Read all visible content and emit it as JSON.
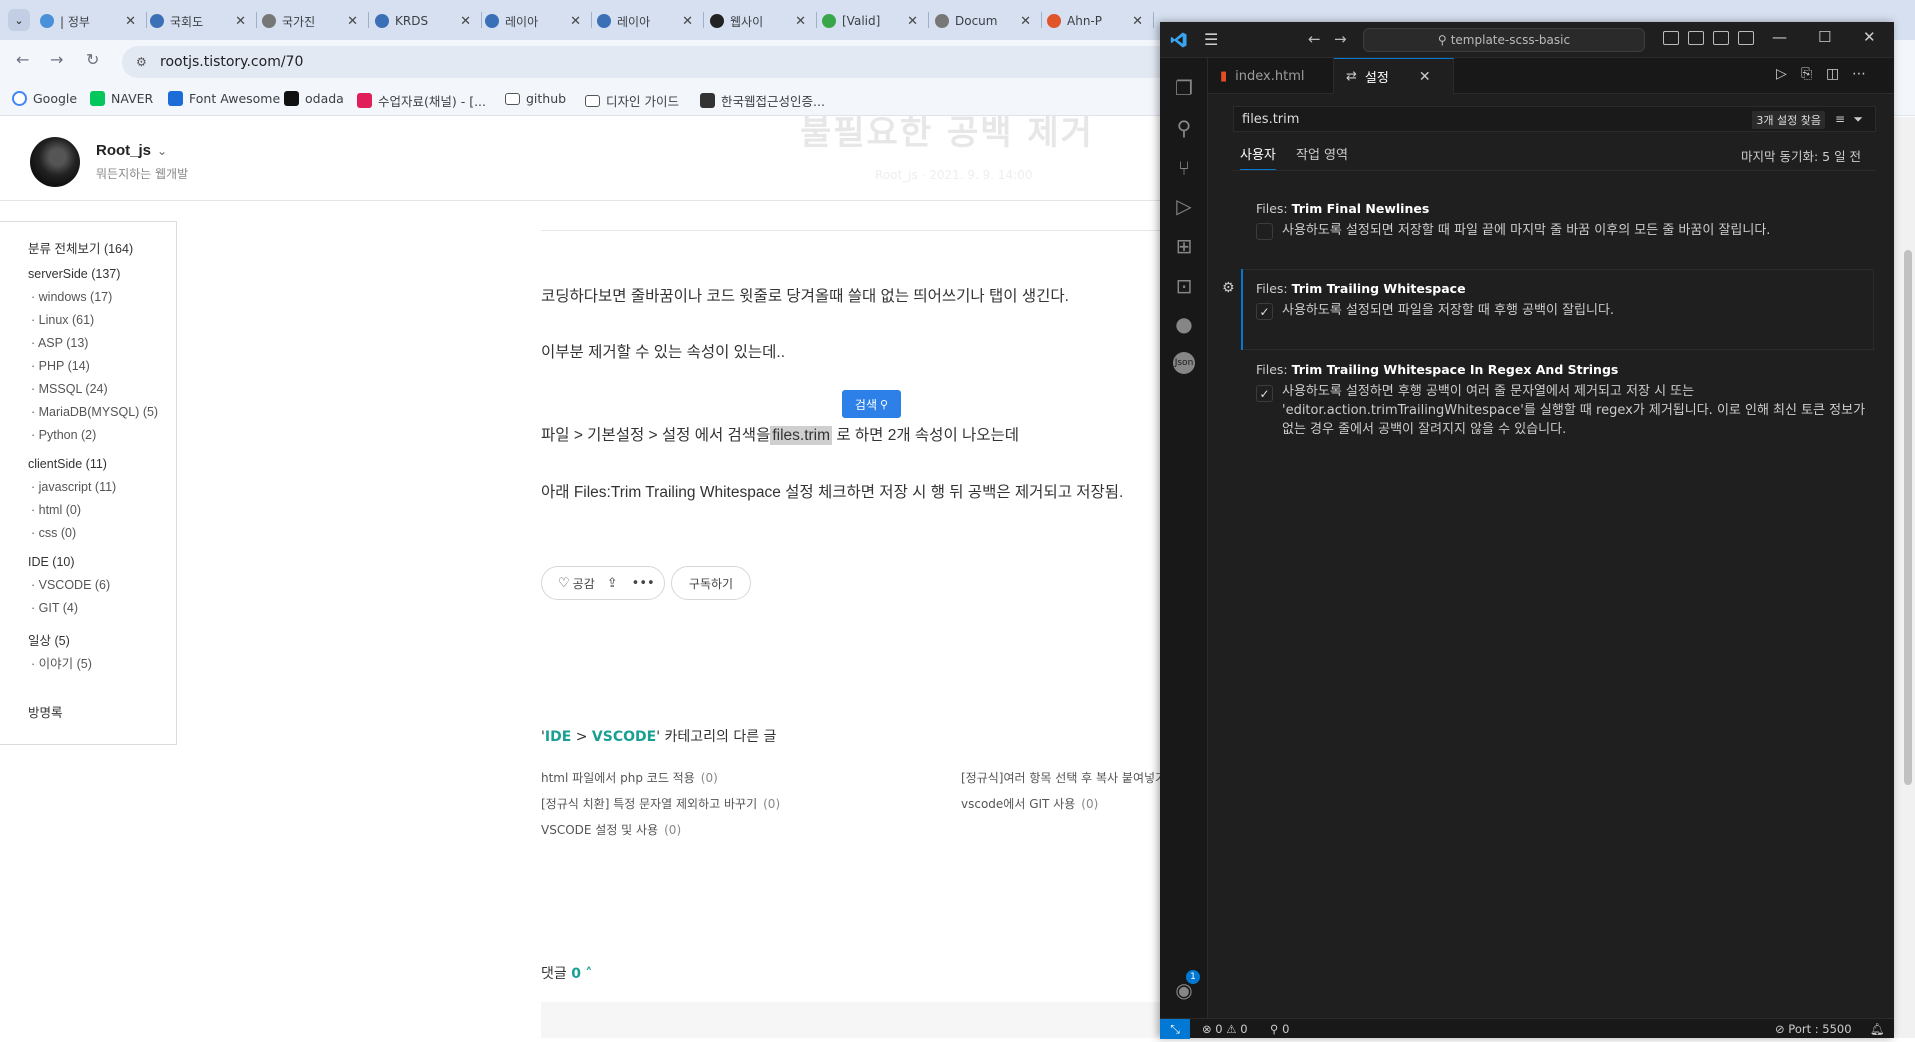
{
  "browser": {
    "tabs": [
      {
        "label": "| 정부",
        "color": "#4a90d9"
      },
      {
        "label": "국회도",
        "color": "#3b6fb6"
      },
      {
        "label": "국가진",
        "color": "#777777"
      },
      {
        "label": "KRDS",
        "color": "#3b6fb6"
      },
      {
        "label": "레이아",
        "color": "#3b6fb6"
      },
      {
        "label": "레이아",
        "color": "#3b6fb6"
      },
      {
        "label": "웹사이",
        "color": "#222222"
      },
      {
        "label": "[Valid]",
        "color": "#3aa64a"
      },
      {
        "label": "Docum",
        "color": "#777777"
      },
      {
        "label": "Ahn-P",
        "color": "#e0552a"
      }
    ],
    "url": "rootjs.tistory.com/70",
    "bookmarks": [
      {
        "label": "Google",
        "icon": "google-icon",
        "color": "#4285f4"
      },
      {
        "label": "NAVER",
        "icon": "naver-icon",
        "color": "#03c75a"
      },
      {
        "label": "Font Awesome",
        "icon": "flag-icon",
        "color": "#1c6bd6"
      },
      {
        "label": "odada",
        "icon": "odada-icon",
        "color": "#111111"
      },
      {
        "label": "수업자료(채널) - [...",
        "icon": "slack-icon",
        "color": "#e01e5a"
      },
      {
        "label": "github",
        "icon": "folder-icon",
        "color": "#ffffff"
      },
      {
        "label": "디자인 가이드",
        "icon": "folder-icon",
        "color": "#ffffff"
      },
      {
        "label": "한국웹접근성인증...",
        "icon": "globe-icon",
        "color": "#333333"
      }
    ]
  },
  "blog": {
    "name": "Root_js",
    "desc": "뭐든지하는 웹개발",
    "ghost_title": "불필요한 공백 제거",
    "ghost_meta": "Root_js · 2021. 9. 9. 14:00",
    "categories": [
      {
        "label": "분류 전체보기 (164)",
        "sub": false
      },
      {
        "label": "serverSide (137)",
        "sub": false
      },
      {
        "label": "· windows (17)",
        "sub": true
      },
      {
        "label": "· Linux (61)",
        "sub": true
      },
      {
        "label": "· ASP (13)",
        "sub": true
      },
      {
        "label": "· PHP (14)",
        "sub": true
      },
      {
        "label": "· MSSQL (24)",
        "sub": true
      },
      {
        "label": "· MariaDB(MYSQL) (5)",
        "sub": true
      },
      {
        "label": "· Python (2)",
        "sub": true
      },
      {
        "label": "clientSide (11)",
        "sub": false
      },
      {
        "label": "· javascript (11)",
        "sub": true
      },
      {
        "label": "· html (0)",
        "sub": true
      },
      {
        "label": "· css (0)",
        "sub": true
      },
      {
        "label": "IDE (10)",
        "sub": false
      },
      {
        "label": "· VSCODE (6)",
        "sub": true
      },
      {
        "label": "· GIT (4)",
        "sub": true
      },
      {
        "label": "일상 (5)",
        "sub": false
      },
      {
        "label": "· 이야기 (5)",
        "sub": true
      },
      {
        "label": "방명록",
        "sub": false
      }
    ],
    "p1": "코딩하다보면 줄바꿈이나 코드 윗줄로 당겨올때 쓸대 없는 띄어쓰기나 탭이 생긴다.",
    "p2": "이부분 제거할 수 있는 속성이 있는데..",
    "search_popup": "검색",
    "p3_before": "파일 > 기본설정 > 설정 에서 검색을",
    "p3_hl": "files.trim",
    "p3_after": "로 하면 2개 속성이 나오는데",
    "p4": "아래 Files:Trim Trailing Whitespace 설정 체크하면 저장 시 행 뒤 공백은 제거되고 저장됨.",
    "like_label": "공감",
    "subscribe_label": "구독하기",
    "related_cat1": "IDE",
    "related_sep": " > ",
    "related_cat2": "VSCODE",
    "related_suffix": "' 카테고리의 다른 글",
    "related": [
      {
        "title": "html 파일에서 php 코드 적용",
        "count": "(0)"
      },
      {
        "title": "[정규식]여러 항목 선택 후 복사 붙여넣기",
        "count": ""
      },
      {
        "title": "[정규식 치환] 특정 문자열 제외하고 바꾸기",
        "count": "(0)"
      },
      {
        "title": "vscode에서 GIT 사용",
        "count": "(0)"
      },
      {
        "title": "VSCODE 설정 및 사용",
        "count": "(0)"
      }
    ],
    "comments_label": "댓글",
    "comments_count": "0"
  },
  "vscode": {
    "search": "template-scss-basic",
    "tabs": [
      {
        "label": "index.html"
      },
      {
        "label": "설정"
      }
    ],
    "settings_query": "files.trim",
    "result_count": "3개 설정 찾음",
    "scope_tabs": [
      "사용자",
      "작업 영역"
    ],
    "last_sync": "마지막 동기화: 5 일 전",
    "settings": [
      {
        "prefix": "Files: ",
        "name": "Trim Final Newlines",
        "checked": false,
        "desc": "사용하도록 설정되면 저장할 때 파일 끝에 마지막 줄 바꿈 이후의 모든 줄 바꿈이 잘립니다."
      },
      {
        "prefix": "Files: ",
        "name": "Trim Trailing Whitespace",
        "checked": true,
        "desc": "사용하도록 설정되면 파일을 저장할 때 후행 공백이 잘립니다."
      },
      {
        "prefix": "Files: ",
        "name": "Trim Trailing Whitespace In Regex And Strings",
        "checked": true,
        "desc": "사용하도록 설정하면 후행 공백이 여러 줄 문자열에서 제거되고 저장 시 또는 'editor.action.trimTrailingWhitespace'를 실행할 때 regex가 제거됩니다. 이로 인해 최신 토큰 정보가 없는 경우 줄에서 공백이 잘려지지 않을 수 있습니다."
      }
    ],
    "status": {
      "errors": "0",
      "warnings": "0",
      "ports": "0",
      "live_port": "Port : 5500"
    },
    "accounts_badge": "1"
  }
}
